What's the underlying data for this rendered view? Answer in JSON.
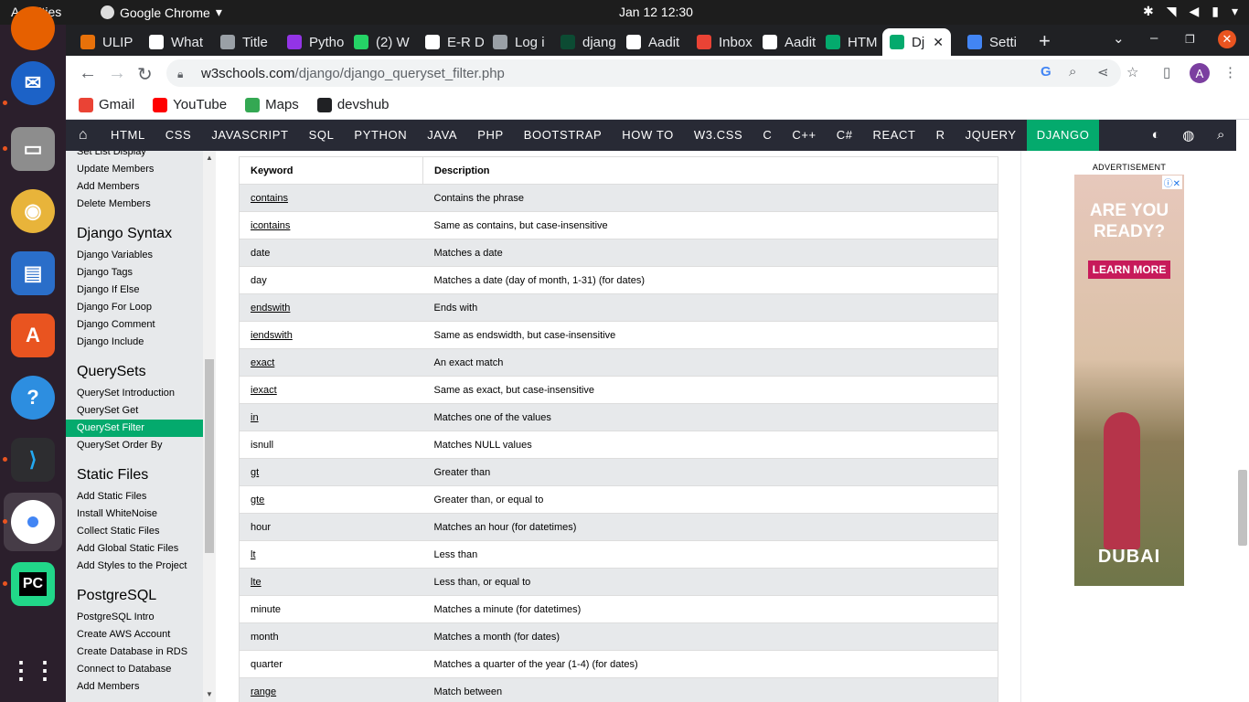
{
  "topbar": {
    "activities": "Activities",
    "app_name": "Google Chrome",
    "clock": "Jan 12  12:30"
  },
  "dock": {
    "items": [
      "firefox-icon",
      "thunderbird-icon",
      "files-icon",
      "rhythmbox-icon",
      "libreoffice-impress-icon",
      "app-center-icon",
      "help-icon",
      "vscode-icon",
      "chrome-icon",
      "pycharm-icon",
      "show-apps-icon"
    ]
  },
  "tabs": [
    {
      "label": "ULIP",
      "color": "#e8710a"
    },
    {
      "label": "What",
      "color": "#ffffff"
    },
    {
      "label": "Title",
      "color": "#9aa0a6"
    },
    {
      "label": "Pytho",
      "color": "#9334e6"
    },
    {
      "label": "(2) W",
      "color": "#25d366"
    },
    {
      "label": "E-R D",
      "color": "#ffffff"
    },
    {
      "label": "Log i",
      "color": "#9aa0a6"
    },
    {
      "label": "djang",
      "color": "#0c4b33"
    },
    {
      "label": "Aadit",
      "color": "#ffffff"
    },
    {
      "label": "Inbox",
      "color": "#ea4335"
    },
    {
      "label": "Aadit",
      "color": "#ffffff"
    },
    {
      "label": "HTM",
      "color": "#04aa6d"
    },
    {
      "label": "Dj",
      "color": "#04aa6d",
      "active": true
    },
    {
      "label": "Setti",
      "color": "#4285f4"
    }
  ],
  "toolbar": {
    "url_host": "w3schools.com",
    "url_path": "/django/django_queryset_filter.php",
    "avatar_letter": "A"
  },
  "bookmarks": [
    {
      "label": "Gmail",
      "color": "#ea4335"
    },
    {
      "label": "YouTube",
      "color": "#ff0000"
    },
    {
      "label": "Maps",
      "color": "#34a853"
    },
    {
      "label": "devshub",
      "color": "#202124"
    }
  ],
  "w3nav": {
    "links": [
      "HTML",
      "CSS",
      "JAVASCRIPT",
      "SQL",
      "PYTHON",
      "JAVA",
      "PHP",
      "BOOTSTRAP",
      "HOW TO",
      "W3.CSS",
      "C",
      "C++",
      "C#",
      "REACT",
      "R",
      "JQUERY",
      "DJANGO"
    ],
    "active": "DJANGO"
  },
  "sidebar": {
    "partial_top": "Set List Display",
    "group0": [
      "Update Members",
      "Add Members",
      "Delete Members"
    ],
    "sections": [
      {
        "title": "Django Syntax",
        "items": [
          "Django Variables",
          "Django Tags",
          "Django If Else",
          "Django For Loop",
          "Django Comment",
          "Django Include"
        ]
      },
      {
        "title": "QuerySets",
        "items": [
          "QuerySet Introduction",
          "QuerySet Get",
          "QuerySet Filter",
          "QuerySet Order By"
        ]
      },
      {
        "title": "Static Files",
        "items": [
          "Add Static Files",
          "Install WhiteNoise",
          "Collect Static Files",
          "Add Global Static Files",
          "Add Styles to the Project"
        ]
      },
      {
        "title": "PostgreSQL",
        "items": [
          "PostgreSQL Intro",
          "Create AWS Account",
          "Create Database in RDS",
          "Connect to Database",
          "Add Members"
        ]
      }
    ],
    "active": "QuerySet Filter"
  },
  "table": {
    "headers": [
      "Keyword",
      "Description"
    ],
    "rows": [
      {
        "kw": "contains",
        "link": true,
        "desc": "Contains the phrase"
      },
      {
        "kw": "icontains",
        "link": true,
        "desc": "Same as contains, but case-insensitive"
      },
      {
        "kw": "date",
        "link": false,
        "desc": "Matches a date"
      },
      {
        "kw": "day",
        "link": false,
        "desc": "Matches a date (day of month, 1-31) (for dates)"
      },
      {
        "kw": "endswith",
        "link": true,
        "desc": "Ends with"
      },
      {
        "kw": "iendswith",
        "link": true,
        "desc": "Same as endswidth, but case-insensitive"
      },
      {
        "kw": "exact",
        "link": true,
        "desc": "An exact match"
      },
      {
        "kw": "iexact",
        "link": true,
        "desc": "Same as exact, but case-insensitive"
      },
      {
        "kw": "in",
        "link": true,
        "desc": "Matches one of the values"
      },
      {
        "kw": "isnull",
        "link": false,
        "desc": "Matches NULL values"
      },
      {
        "kw": "gt",
        "link": true,
        "desc": "Greater than"
      },
      {
        "kw": "gte",
        "link": true,
        "desc": "Greater than, or equal to"
      },
      {
        "kw": "hour",
        "link": false,
        "desc": "Matches an hour (for datetimes)"
      },
      {
        "kw": "lt",
        "link": true,
        "desc": "Less than"
      },
      {
        "kw": "lte",
        "link": true,
        "desc": "Less than, or equal to"
      },
      {
        "kw": "minute",
        "link": false,
        "desc": "Matches a minute (for datetimes)"
      },
      {
        "kw": "month",
        "link": false,
        "desc": "Matches a month (for dates)"
      },
      {
        "kw": "quarter",
        "link": false,
        "desc": "Matches a quarter of the year (1-4) (for dates)"
      },
      {
        "kw": "range",
        "link": true,
        "desc": "Match between"
      }
    ]
  },
  "ad": {
    "label": "ADVERTISEMENT",
    "headline": "ARE YOU READY?",
    "cta": "LEARN MORE",
    "brand": "DUBAI"
  }
}
